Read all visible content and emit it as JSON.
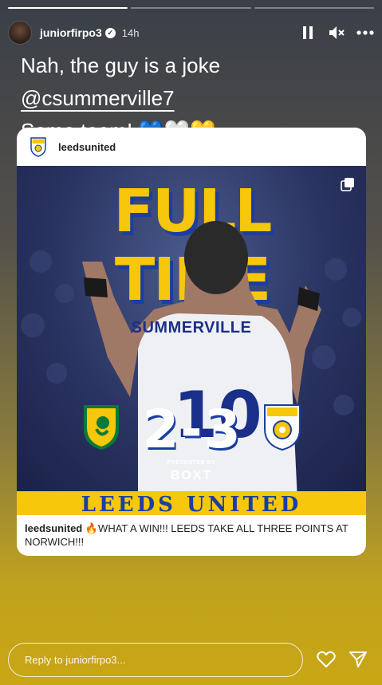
{
  "story": {
    "progress_segments": 3,
    "progress_done": 1,
    "username": "juniorfirpo3",
    "time": "14h",
    "caption_line1_prefix": "Nah, the guy is a joke ",
    "caption_mention": "@csummerville7",
    "caption_line2": "Some team! 💙🤍💛"
  },
  "shared_post": {
    "account": "leedsunited",
    "headline": "FULL TIME",
    "jersey_name": "SUMMERVILLE",
    "score": "2-3",
    "presented_by": "PRESENTED BY",
    "sponsor": "BOXT",
    "banner": "LEEDS UNITED",
    "caption_user": "leedsunited",
    "caption_text": " 🔥WHAT A WIN!!! LEEDS TAKE ALL THREE POINTS AT NORWICH!!!"
  },
  "reply": {
    "placeholder": "Reply to juniorfirpo3..."
  },
  "colors": {
    "leeds_yellow": "#f6c70a",
    "leeds_blue": "#1b3ea1",
    "norwich_green": "#0a7a3a"
  }
}
